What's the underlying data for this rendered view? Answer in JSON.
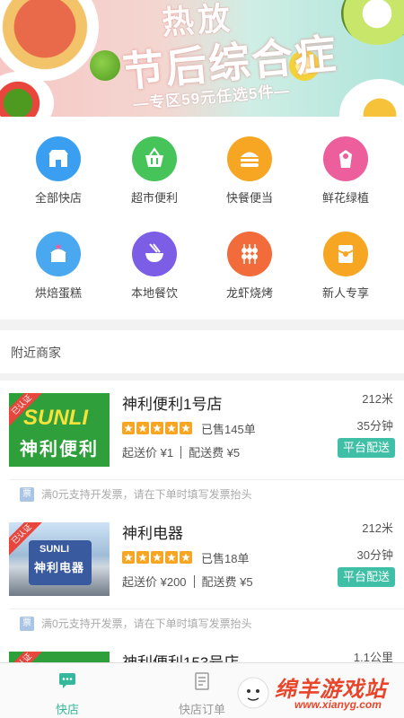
{
  "banner": {
    "title_top": "热放",
    "title_main": "节后综合症",
    "subtitle": "—专区59元任选5件—"
  },
  "categories": [
    {
      "label": "全部快店",
      "icon": "store-icon",
      "color": "#3a9ff0"
    },
    {
      "label": "超市便利",
      "icon": "basket-icon",
      "color": "#46c45a"
    },
    {
      "label": "快餐便当",
      "icon": "burger-icon",
      "color": "#f6a623"
    },
    {
      "label": "鲜花绿植",
      "icon": "flower-icon",
      "color": "#ec5e9c"
    },
    {
      "label": "烘焙蛋糕",
      "icon": "cake-icon",
      "color": "#4aa8f0"
    },
    {
      "label": "本地餐饮",
      "icon": "noodle-bowl-icon",
      "color": "#7c5de6"
    },
    {
      "label": "龙虾烧烤",
      "icon": "skewer-icon",
      "color": "#f26b3a"
    },
    {
      "label": "新人专享",
      "icon": "gift-envelope-icon",
      "color": "#f6a623"
    }
  ],
  "nearby": {
    "title": "附近商家"
  },
  "shops": [
    {
      "badge": "已认证",
      "name": "神利便利1号店",
      "rating": 5,
      "sold": "已售145单",
      "min_order": "起送价 ¥1",
      "delivery_fee": "配送费 ¥5",
      "distance": "212米",
      "time": "35分钟",
      "delivery": "平台配送",
      "invoice_tag": "票",
      "invoice_text": "满0元支持开发票，请在下单时填写发票抬头",
      "logo_brand": "SUNLI",
      "logo_cn": "神利便利"
    },
    {
      "badge": "已认证",
      "name": "神利电器",
      "rating": 5,
      "sold": "已售18单",
      "min_order": "起送价 ¥200",
      "delivery_fee": "配送费 ¥5",
      "distance": "212米",
      "time": "30分钟",
      "delivery": "平台配送",
      "invoice_tag": "票",
      "invoice_text": "满0元支持开发票，请在下单时填写发票抬头",
      "logo_brand": "SUNLI",
      "logo_cn": "神利电器"
    },
    {
      "badge": "已认证",
      "name": "神利便利153号店",
      "distance": "1.1公里"
    }
  ],
  "tabs": [
    {
      "label": "快店",
      "icon": "chat-bubble-icon"
    },
    {
      "label": "快店订单",
      "icon": "order-list-icon"
    }
  ],
  "watermark": {
    "text": "绵羊游戏站",
    "url": "www.xianyg.com"
  },
  "colors": {
    "accent": "#3fbfa6",
    "star": "#f6a623",
    "badge": "#e8453c"
  }
}
